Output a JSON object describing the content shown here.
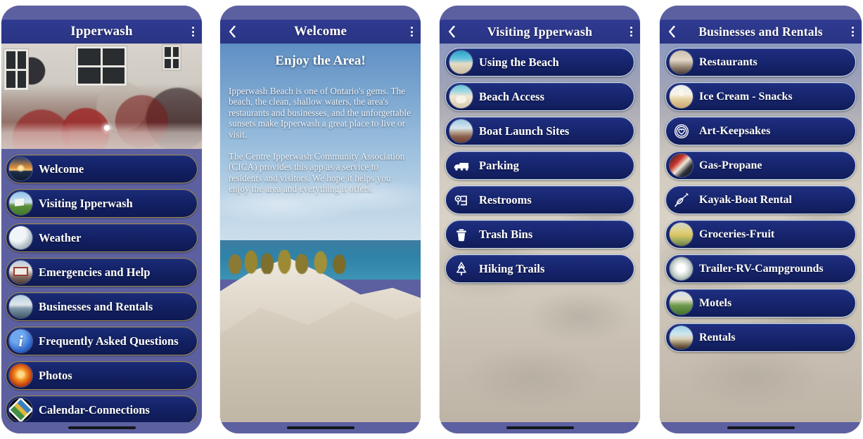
{
  "phones": [
    {
      "id": "home",
      "header": {
        "title": "Ipperwash",
        "back_icon": "chevron-left-icon",
        "has_back": false,
        "menu_icon": "kebab-menu-icon"
      },
      "hero_caption": "community-dinner-photo",
      "menu": [
        {
          "label": "Welcome",
          "icon": "sunset-thumbnail-icon"
        },
        {
          "label": "Visiting Ipperwash",
          "icon": "village-thumbnail-icon"
        },
        {
          "label": "Weather",
          "icon": "weather-thumbnail-icon"
        },
        {
          "label": "Emergencies and Help",
          "icon": "firehall-thumbnail-icon"
        },
        {
          "label": "Businesses and Rentals",
          "icon": "pier-thumbnail-icon"
        },
        {
          "label": "Frequently Asked Questions",
          "icon": "info-thumbnail-icon"
        },
        {
          "label": "Photos",
          "icon": "photos-thumbnail-icon"
        },
        {
          "label": "Calendar-Connections",
          "icon": "calendar-diamond-icon"
        }
      ]
    },
    {
      "id": "welcome",
      "header": {
        "title": "Welcome",
        "back_icon": "chevron-left-icon",
        "has_back": true,
        "menu_icon": "kebab-menu-icon"
      },
      "content": {
        "title": "Enjoy the Area!",
        "paragraphs": [
          "Ipperwash Beach is one of Ontario's gems. The beach, the clean, shallow waters, the area's restaurants and businesses, and the unforgettable sunsets make Ipperwash a great place to live or visit.",
          "The Centre Ipperwash Community Association (CICA) provides this app as a service to residents and visitors. We hope it helps you enjoy the area and everything it offers."
        ]
      }
    },
    {
      "id": "visiting",
      "header": {
        "title": "Visiting Ipperwash",
        "back_icon": "chevron-left-icon",
        "has_back": true,
        "menu_icon": "kebab-menu-icon"
      },
      "menu": [
        {
          "label": "Using the Beach",
          "icon": "beach-thumbnail-icon"
        },
        {
          "label": "Beach Access",
          "icon": "beach-access-thumbnail-icon"
        },
        {
          "label": "Boat Launch Sites",
          "icon": "boat-launch-thumbnail-icon"
        },
        {
          "label": "Parking",
          "icon": "car-parking-icon"
        },
        {
          "label": "Restrooms",
          "icon": "restroom-icon"
        },
        {
          "label": "Trash Bins",
          "icon": "trash-bin-icon"
        },
        {
          "label": "Hiking Trails",
          "icon": "pine-tree-hiking-icon"
        }
      ]
    },
    {
      "id": "businesses",
      "header": {
        "title": "Businesses and Rentals",
        "back_icon": "chevron-left-icon",
        "has_back": true,
        "menu_icon": "kebab-menu-icon"
      },
      "menu": [
        {
          "label": "Restaurants",
          "icon": "restaurant-thumbnail-icon"
        },
        {
          "label": "Ice Cream - Snacks",
          "icon": "ice-cream-thumbnail-icon"
        },
        {
          "label": "Art-Keepsakes",
          "icon": "art-heart-badge-icon"
        },
        {
          "label": "Gas-Propane",
          "icon": "gas-propane-thumbnail-icon"
        },
        {
          "label": "Kayak-Boat Rental",
          "icon": "kayak-icon"
        },
        {
          "label": "Groceries-Fruit",
          "icon": "groceries-thumbnail-icon"
        },
        {
          "label": "Trailer-RV-Campgrounds",
          "icon": "campground-thumbnail-icon"
        },
        {
          "label": "Motels",
          "icon": "motel-thumbnail-icon"
        },
        {
          "label": "Rentals",
          "icon": "rental-cottage-thumbnail-icon"
        }
      ]
    }
  ],
  "colors": {
    "bezel": "#5c60a0",
    "header": "#2f3b91",
    "pill_navy": "#16246d",
    "pill_border_gold": "#a08a4e",
    "pill_border_light": "#cfe0f2",
    "text_white": "#ffffff"
  }
}
